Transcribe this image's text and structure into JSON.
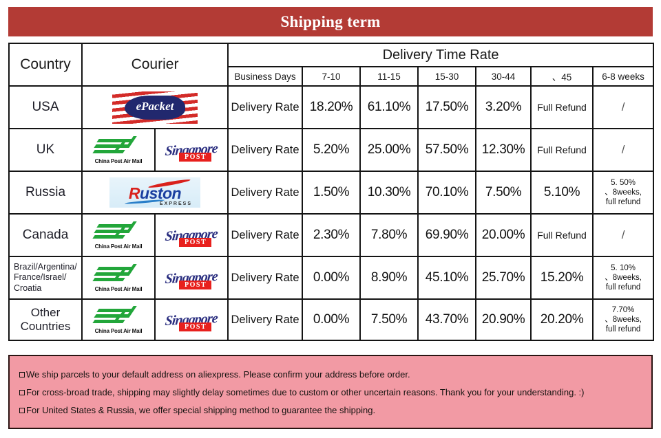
{
  "banner": {
    "title": "Shipping term"
  },
  "table": {
    "headers": {
      "country": "Country",
      "courier": "Courier",
      "delivery_time_rate": "Delivery Time Rate",
      "business_days": "Business Days",
      "c_7_10": "7-10",
      "c_11_15": "11-15",
      "c_15_30": "15-30",
      "c_30_44": "30-44",
      "c_over_45": "、45",
      "c_6_8_weeks": "6-8 weeks"
    },
    "rows": [
      {
        "country": "USA",
        "couriers": [
          "epacket"
        ],
        "courier_labels": [
          "ePacket"
        ],
        "rate_label": "Delivery Rate",
        "d7_10": "18.20%",
        "d11_15": "61.10%",
        "d15_30": "17.50%",
        "d30_44": "3.20%",
        "over45": "Full Refund",
        "weeks68": "/"
      },
      {
        "country": "UK",
        "couriers": [
          "chinapost",
          "sgpost"
        ],
        "courier_labels": [
          "China Post Air Mail",
          "Singapore POST"
        ],
        "rate_label": "Delivery Rate",
        "d7_10": "5.20%",
        "d11_15": "25.00%",
        "d15_30": "57.50%",
        "d30_44": "12.30%",
        "over45": "Full Refund",
        "weeks68": "/"
      },
      {
        "country": "Russia",
        "couriers": [
          "ruston"
        ],
        "courier_labels": [
          "Ruston EXPRESS"
        ],
        "rate_label": "Delivery Rate",
        "d7_10": "1.50%",
        "d11_15": "10.30%",
        "d15_30": "70.10%",
        "d30_44": "7.50%",
        "over45": "5.10%",
        "weeks68_lines": [
          "5. 50%",
          "、8weeks,",
          "full refund"
        ]
      },
      {
        "country": "Canada",
        "couriers": [
          "chinapost",
          "sgpost"
        ],
        "courier_labels": [
          "China Post Air Mail",
          "Singapore POST"
        ],
        "rate_label": "Delivery Rate",
        "d7_10": "2.30%",
        "d11_15": "7.80%",
        "d15_30": "69.90%",
        "d30_44": "20.00%",
        "over45": "Full Refund",
        "weeks68": "/"
      },
      {
        "country": "Brazil/Argentina/France/Israel/Croatia",
        "country_lines": [
          "Brazil/Argentina/",
          "France/Israel/",
          "Croatia"
        ],
        "couriers": [
          "chinapost",
          "sgpost"
        ],
        "courier_labels": [
          "China Post Air Mail",
          "Singapore POST"
        ],
        "rate_label": "Delivery Rate",
        "d7_10": "0.00%",
        "d11_15": "8.90%",
        "d15_30": "45.10%",
        "d30_44": "25.70%",
        "over45": "15.20%",
        "weeks68_lines": [
          "5. 10%",
          "、8weeks,",
          "full refund"
        ]
      },
      {
        "country": "Other Countries",
        "couriers": [
          "chinapost",
          "sgpost"
        ],
        "courier_labels": [
          "China Post Air Mail",
          "Singapore POST"
        ],
        "rate_label": "Delivery Rate",
        "d7_10": "0.00%",
        "d11_15": "7.50%",
        "d15_30": "43.70%",
        "d30_44": "20.90%",
        "over45": "20.20%",
        "weeks68_lines": [
          "7.70%",
          "、8weeks,",
          "full refund"
        ]
      }
    ]
  },
  "notes": [
    "We ship parcels to your default address on aliexpress. Please confirm your address before order.",
    "For cross-broad trade, shipping may slightly delay sometimes due to custom or other uncertain reasons. Thank you for your understanding. :)",
    "For United States & Russia, we offer special shipping method to guarantee the shipping."
  ],
  "logos": {
    "epacket": {
      "text": "ePacket"
    },
    "chinapost": {
      "text": "China Post Air Mail"
    },
    "sgpost": {
      "script": "Singapore",
      "box": "POST"
    },
    "ruston": {
      "first": "R",
      "rest": "uston",
      "sub": "EXPRESS"
    }
  },
  "colors": {
    "banner": "#b33b35",
    "header_yellow": "#f2f0ab",
    "country_lavender": "#c5c0e0",
    "notes_pink": "#f29aa4",
    "border": "#141414"
  }
}
